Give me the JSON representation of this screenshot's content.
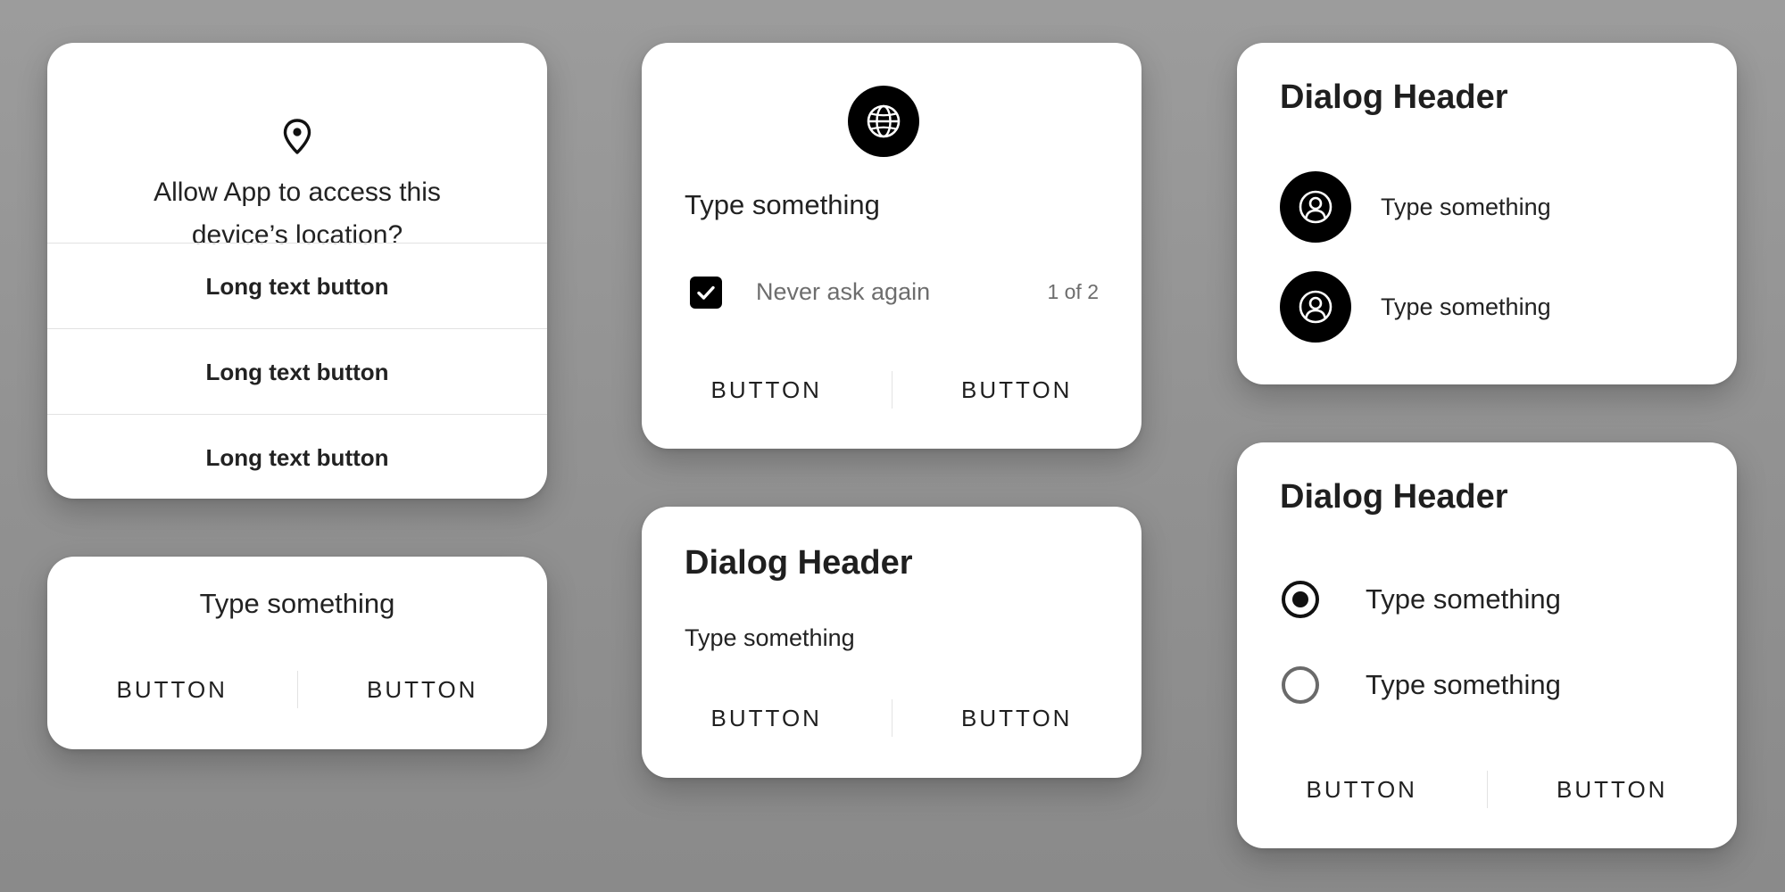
{
  "location_dialog": {
    "title_line1": "Allow App to access this",
    "title_line2": "device’s location?",
    "buttons": [
      "Long text button",
      "Long text button",
      "Long text button"
    ],
    "icon": "location-pin-icon"
  },
  "simple_dialog": {
    "message": "Type something",
    "button_left": "BUTTON",
    "button_right": "BUTTON"
  },
  "globe_dialog": {
    "icon": "globe-icon",
    "message": "Type something",
    "checkbox_label": "Never ask again",
    "checkbox_checked": true,
    "pager": "1 of 2",
    "button_left": "BUTTON",
    "button_right": "BUTTON"
  },
  "header_text_dialog": {
    "header": "Dialog Header",
    "message": "Type something",
    "button_left": "BUTTON",
    "button_right": "BUTTON"
  },
  "account_dialog": {
    "header": "Dialog Header",
    "items": [
      {
        "label": "Type something",
        "icon": "account-circle-icon"
      },
      {
        "label": "Type something",
        "icon": "account-circle-icon"
      }
    ]
  },
  "radio_dialog": {
    "header": "Dialog Header",
    "options": [
      {
        "label": "Type something",
        "selected": true
      },
      {
        "label": "Type something",
        "selected": false
      }
    ],
    "button_left": "BUTTON",
    "button_right": "BUTTON"
  },
  "colors": {
    "background": "#929292",
    "surface": "#ffffff",
    "text": "#1f1f1f",
    "muted": "#6d6d6d",
    "accent": "#000000"
  }
}
